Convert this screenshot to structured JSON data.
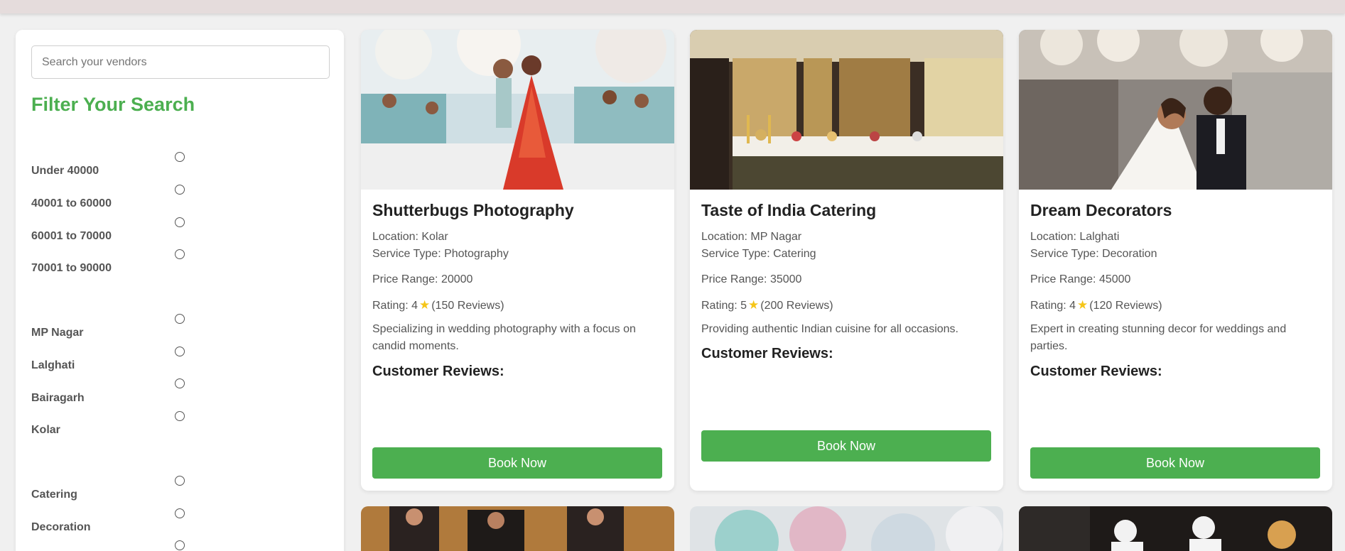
{
  "search": {
    "placeholder": "Search your vendors"
  },
  "filter": {
    "title": "Filter Your Search",
    "price_options": [
      "Under 40000",
      "40001 to 60000",
      "60001 to 70000",
      "70001 to 90000"
    ],
    "location_options": [
      "MP Nagar",
      "Lalghati",
      "Bairagarh",
      "Kolar"
    ],
    "service_options": [
      "Catering",
      "Decoration"
    ]
  },
  "vendors": [
    {
      "name": "Shutterbugs Photography",
      "location": "Location: Kolar",
      "service": "Service Type: Photography",
      "price": "Price Range: 20000",
      "rating_prefix": "Rating: 4",
      "rating_reviews": "(150 Reviews)",
      "description": "Specializing in wedding photography with a focus on candid moments.",
      "reviews_heading": "Customer Reviews:",
      "button": "Book Now"
    },
    {
      "name": "Taste of India Catering",
      "location": "Location: MP Nagar",
      "service": "Service Type: Catering",
      "price": "Price Range: 35000",
      "rating_prefix": "Rating: 5",
      "rating_reviews": "(200 Reviews)",
      "description": "Providing authentic Indian cuisine for all occasions.",
      "reviews_heading": "Customer Reviews:",
      "button": "Book Now"
    },
    {
      "name": "Dream Decorators",
      "location": "Location: Lalghati",
      "service": "Service Type: Decoration",
      "price": "Price Range: 45000",
      "rating_prefix": "Rating: 4",
      "rating_reviews": "(120 Reviews)",
      "description": "Expert in creating stunning decor for weddings and parties.",
      "reviews_heading": "Customer Reviews:",
      "button": "Book Now"
    }
  ],
  "icons": {
    "rating": "star-icon"
  },
  "colors": {
    "accent": "#4caf50",
    "star": "#f5c518"
  }
}
